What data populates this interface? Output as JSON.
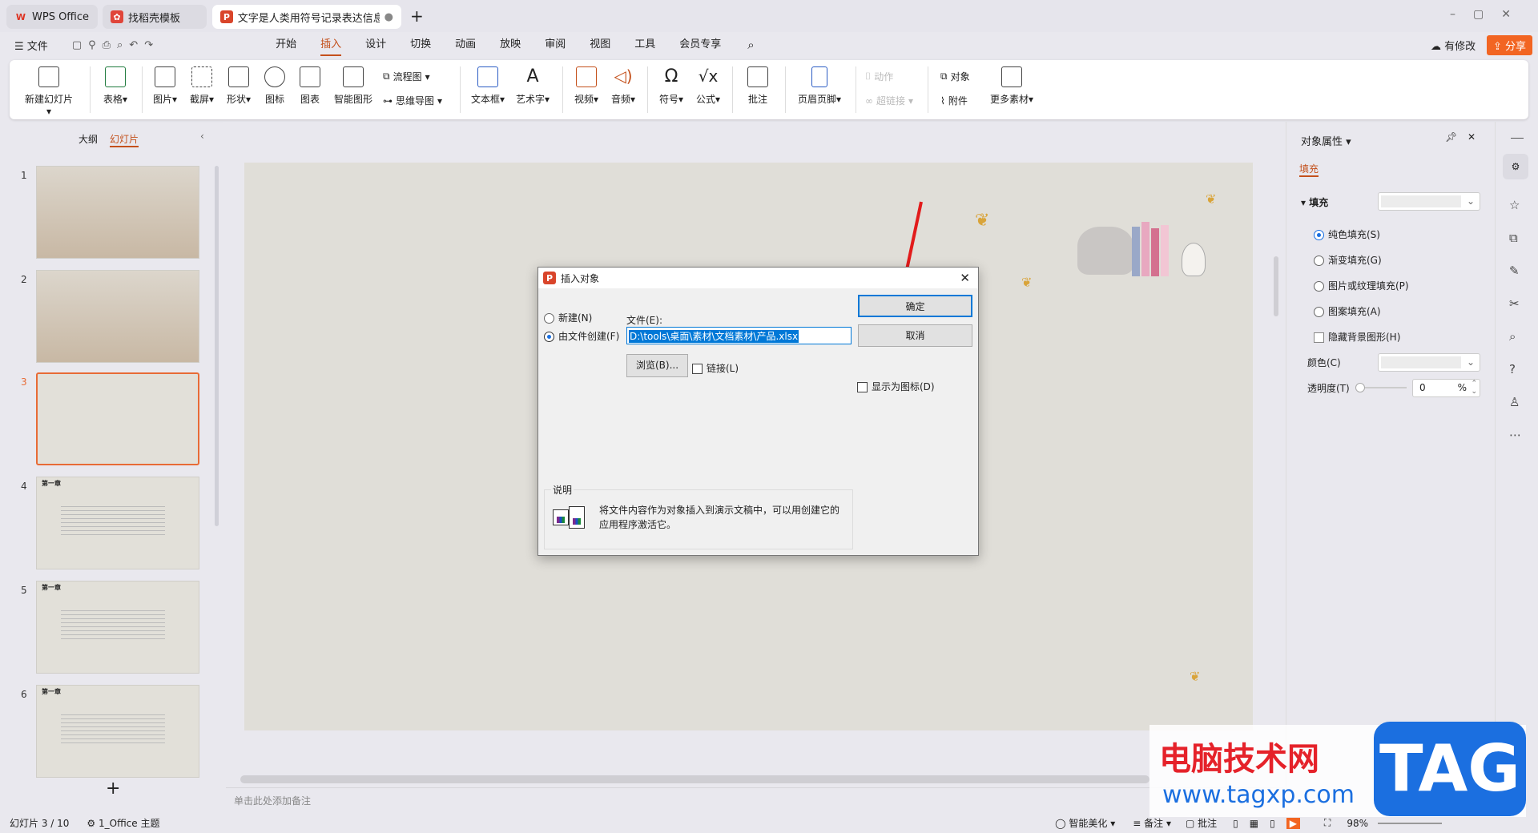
{
  "tabs": [
    {
      "label": "WPS Office"
    },
    {
      "label": "找稻壳模板"
    },
    {
      "label": "文字是人类用符号记录表达信息以"
    }
  ],
  "menu": {
    "file": "文件",
    "items": [
      "开始",
      "插入",
      "设计",
      "切换",
      "动画",
      "放映",
      "审阅",
      "视图",
      "工具",
      "会员专享"
    ],
    "active": "插入",
    "modified": "有修改",
    "share": "分享"
  },
  "ribbon": {
    "new_slide": "新建幻灯片",
    "table": "表格",
    "picture": "图片",
    "screenshot": "截屏",
    "shape": "形状",
    "icon": "图标",
    "chart": "图表",
    "smartart": "智能图形",
    "flowchart": "流程图",
    "mindmap": "思维导图",
    "textbox": "文本框",
    "wordart": "艺术字",
    "video": "视频",
    "audio": "音频",
    "symbol": "符号",
    "formula": "公式",
    "comment": "批注",
    "header_footer": "页眉页脚",
    "action": "动作",
    "hyperlink": "超链接",
    "object": "对象",
    "attachment": "附件",
    "more": "更多素材"
  },
  "left_panel": {
    "tab_outline": "大纲",
    "tab_slides": "幻灯片",
    "slides": [
      {
        "num": "1"
      },
      {
        "num": "2"
      },
      {
        "num": "3"
      },
      {
        "num": "4",
        "heading": "第一章"
      },
      {
        "num": "5",
        "heading": "第一章"
      },
      {
        "num": "6",
        "heading": "第一章"
      }
    ],
    "add": "+"
  },
  "notes_placeholder": "单击此处添加备注",
  "dialog": {
    "title": "插入对象",
    "new_label": "新建(N)",
    "from_file_label": "由文件创建(F)",
    "file_label": "文件(E):",
    "file_value": "D:\\tools\\桌面\\素材\\文档素材\\产品.xlsx",
    "browse": "浏览(B)...",
    "link": "链接(L)",
    "ok": "确定",
    "cancel": "取消",
    "display_icon": "显示为图标(D)",
    "desc_title": "说明",
    "desc_text": "将文件内容作为对象插入到演示文稿中，可以用创建它的应用程序激活它。"
  },
  "right_panel": {
    "title": "对象属性",
    "tab": "填充",
    "section": "填充",
    "options": [
      "纯色填充(S)",
      "渐变填充(G)",
      "图片或纹理填充(P)",
      "图案填充(A)"
    ],
    "hide_bg": "隐藏背景图形(H)",
    "color_label": "颜色(C)",
    "transparency_label": "透明度(T)",
    "transparency_value": "0",
    "percent": "%"
  },
  "status": {
    "slide": "幻灯片 3 / 10",
    "theme": "1_Office 主题",
    "beautify": "智能美化",
    "notes": "备注",
    "comment": "批注",
    "zoom": "98%"
  },
  "watermark": {
    "cn": "电脑技术网",
    "url": "www.tagxp.com",
    "tag": "TAG"
  },
  "colors": {
    "accent": "#c4501b",
    "share": "#f26522",
    "select": "#0078d7"
  }
}
